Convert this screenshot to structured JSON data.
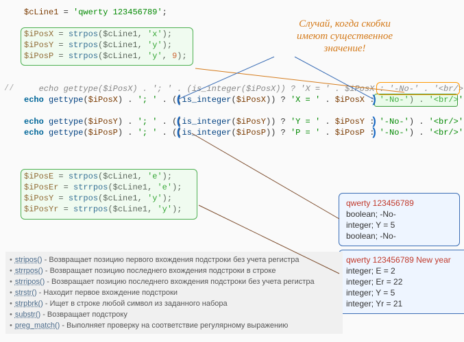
{
  "code": {
    "l1_var": "$cLine1",
    "l1_eq": " = ",
    "l1_str": "'qwerty 123456789'",
    "l1_sc": ";",
    "l3_var": "$iPosX",
    "l3_eq": " = ",
    "l3_fn": "strpos",
    "l3_args": "($cLine1, ",
    "l3_arg2": "'x'",
    "l3_end": ");",
    "l4_var": "$iPosY",
    "l4_eq": " = ",
    "l4_fn": "strpos",
    "l4_args": "($cLine1, ",
    "l4_arg2": "'y'",
    "l4_end": ");",
    "l5_var": "$iPosP",
    "l5_eq": " = ",
    "l5_fn": "strpos",
    "l5_args": "($cLine1, ",
    "l5_arg2": "'y'",
    "l5_c": ", ",
    "l5_arg3": "9",
    "l5_end": ");",
    "l7_cmt": "   echo gettype($iPosX) . '; ' . (is_integer($iPosX)) ? 'X = ' . $iPosX : '-No-' . '<br/>';",
    "e1_kw": "echo ",
    "e1_fn": "gettype",
    "e1_a": "(",
    "e1_v": "$iPosX",
    "e1_b": ") . ",
    "e1_s1": "'; '",
    "e1_c": " . (",
    "e1_paren": "(",
    "e1_fn2": "is_integer",
    "e1_d": "(",
    "e1_v2": "$iPosX",
    "e1_e": ")",
    "e1_paren2": ")",
    "e1_f": " ? ",
    "e1_s2": "'X = '",
    "e1_g": " . ",
    "e1_v3": "$iPosX",
    "e1_h": " : ",
    "e1_s3": "'-No-'",
    "e1_paren3": ")",
    "e1_i": " . ",
    "e1_s4": "'<br/>'",
    "e1_j": ";",
    "e2_kw": "echo ",
    "e2_fn": "gettype",
    "e2_a": "(",
    "e2_v": "$iPosY",
    "e2_b": ") . ",
    "e2_s1": "'; '",
    "e2_c": " . (",
    "e2_paren": "(",
    "e2_fn2": "is_integer",
    "e2_d": "(",
    "e2_v2": "$iPosY",
    "e2_e": ")",
    "e2_paren2": ")",
    "e2_f": " ? ",
    "e2_s2": "'Y = '",
    "e2_g": " . ",
    "e2_v3": "$iPosY",
    "e2_h": " : ",
    "e2_s3": "'-No-'",
    "e2_paren3": ")",
    "e2_i": " . ",
    "e2_s4": "'<br/>'",
    "e2_j": ";",
    "e3_kw": "echo ",
    "e3_fn": "gettype",
    "e3_a": "(",
    "e3_v": "$iPosP",
    "e3_b": ") . ",
    "e3_s1": "'; '",
    "e3_c": " . (",
    "e3_paren": "(",
    "e3_fn2": "is_integer",
    "e3_d": "(",
    "e3_v2": "$iPosP",
    "e3_e": ")",
    "e3_paren2": ")",
    "e3_f": " ? ",
    "e3_s2": "'P = '",
    "e3_g": " . ",
    "e3_v3": "$iPosP",
    "e3_h": " : ",
    "e3_s3": "'-No-'",
    "e3_paren3": ")",
    "e3_i": " . ",
    "e3_s4": "'<br/>'",
    "e3_j": ";",
    "b1_var": "$iPosE",
    "b1_eq": " = ",
    "b1_fn": "strpos",
    "b1_args": "($cLine1, ",
    "b1_arg2": "'e'",
    "b1_end": ");",
    "b2_var": "$iPosEr",
    "b2_eq": " = ",
    "b2_fn": "strrpos",
    "b2_args": "($cLine1, ",
    "b2_arg2": "'e'",
    "b2_end": ");",
    "b3_var": "$iPosY",
    "b3_eq": " = ",
    "b3_fn": "strpos",
    "b3_args": "($cLine1, ",
    "b3_arg2": "'y'",
    "b3_end": ");",
    "b4_var": "$iPosYr",
    "b4_eq": " = ",
    "b4_fn": "strrpos",
    "b4_args": "($cLine1, ",
    "b4_arg2": "'y'",
    "b4_end": ");"
  },
  "annotation": {
    "l1": "Случай, когда скобки",
    "l2": "имеют существенное",
    "l3": "значение!"
  },
  "output1": {
    "title": "qwerty 123456789",
    "r1": "boolean; -No-",
    "r2": "integer; Y = 5",
    "r3": "boolean; -No-"
  },
  "output2": {
    "title": "qwerty 123456789 New year",
    "r1": "integer; E = 2",
    "r2": "integer; Er = 22",
    "r3": "integer; Y = 5",
    "r4": "integer; Yr = 21"
  },
  "funclist": {
    "f1n": "stripos()",
    "f1d": " - Возвращает позицию первого вхождения подстроки без учета регистра",
    "f2n": "strrpos()",
    "f2d": " - Возвращает позицию последнего вхождения подстроки в строке",
    "f3n": "strripos()",
    "f3d": " - Возвращает позицию последнего вхождения подстроки без учета регистра",
    "f4n": "strstr()",
    "f4d": " - Находит первое вхождение подстроки",
    "f5n": "strpbrk()",
    "f5d": " - Ищет в строке любой символ из заданного набора",
    "f6n": "substr()",
    "f6d": " - Возвращает подстроку",
    "f7n": "preg_match()",
    "f7d": " - Выполняет проверку на соответствие регулярному выражению"
  },
  "marker": "//"
}
